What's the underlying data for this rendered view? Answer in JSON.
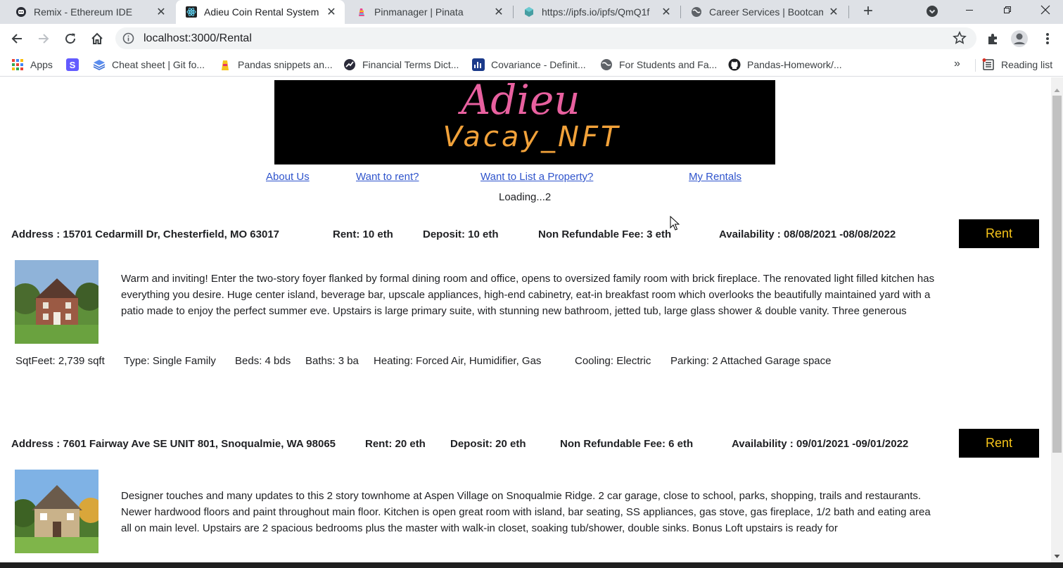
{
  "browser": {
    "tabs": [
      {
        "title": "Remix - Ethereum IDE",
        "icon": "remix-icon"
      },
      {
        "title": "Adieu Coin Rental System",
        "icon": "react-icon"
      },
      {
        "title": "Pinmanager | Pinata",
        "icon": "pinata-icon"
      },
      {
        "title": "https://ipfs.io/ipfs/QmQ1f",
        "icon": "ipfs-cube-icon"
      },
      {
        "title": "Career Services | Bootcamp",
        "icon": "globe-icon"
      }
    ],
    "active_tab_index": 1,
    "url": "localhost:3000/Rental",
    "bookmarks": [
      {
        "label": "Apps",
        "icon": "apps-grid-icon"
      },
      {
        "label": "",
        "icon": "s-bookmark-icon"
      },
      {
        "label": "Cheat sheet | Git fo...",
        "icon": "blue-stack-icon"
      },
      {
        "label": "Pandas snippets an...",
        "icon": "yellow-bookmark-icon"
      },
      {
        "label": "Financial Terms Dict...",
        "icon": "investopedia-icon"
      },
      {
        "label": "Covariance - Definit...",
        "icon": "chart-bookmark-icon"
      },
      {
        "label": "For Students and Fa...",
        "icon": "globe-icon"
      },
      {
        "label": "Pandas-Homework/...",
        "icon": "github-icon"
      }
    ],
    "reading_list": "Reading list"
  },
  "site": {
    "banner": {
      "line1": "Adieu",
      "line2": "Vacay_NFT"
    },
    "nav": [
      "About Us",
      "Want to rent?",
      "Want to List a Property?",
      "My Rentals"
    ],
    "loading_text": "Loading...2"
  },
  "listings": [
    {
      "address": "Address : 15701 Cedarmill Dr, Chesterfield, MO 63017",
      "rent": "Rent: 10 eth",
      "deposit": "Deposit: 10 eth",
      "fee": "Non Refundable Fee: 3 eth",
      "availability": "Availability : 08/08/2021 -08/08/2022",
      "button": "Rent",
      "description": "Warm and inviting! Enter the two-story foyer flanked by formal dining room and office, opens to oversized family room with brick fireplace. The renovated light filled kitchen has everything you desire. Huge center island, beverage bar, upscale appliances, high-end cabinetry, eat-in breakfast room which overlooks the beautifully maintained yard with a patio made to enjoy the perfect summer eve. Upstairs is large primary suite, with stunning new bathroom, jetted tub, large glass shower & double vanity. Three generous",
      "features": {
        "sqft": "SqtFeet: 2,739 sqft",
        "type": "Type: Single Family",
        "beds": "Beds: 4 bds",
        "baths": "Baths: 3 ba",
        "heating": "Heating: Forced Air, Humidifier, Gas",
        "cooling": "Cooling: Electric",
        "parking": "Parking: 2 Attached Garage space"
      }
    },
    {
      "address": "Address : 7601 Fairway Ave SE UNIT 801, Snoqualmie, WA 98065",
      "rent": "Rent: 20 eth",
      "deposit": "Deposit: 20 eth",
      "fee": "Non Refundable Fee: 6 eth",
      "availability": "Availability : 09/01/2021 -09/01/2022",
      "button": "Rent",
      "description": "Designer touches and many updates to this 2 story townhome at Aspen Village on Snoqualmie Ridge. 2 car garage, close to school, parks, shopping, trails and restaurants. Newer hardwood floors and paint throughout main floor. Kitchen is open great room with island, bar seating, SS appliances, gas stove, gas fireplace, 1/2 bath and eating area all on main level. Upstairs are 2 spacious bedrooms plus the master with walk-in closet, soaking tub/shower, double sinks. Bonus Loft upstairs is ready for"
    }
  ],
  "colors": {
    "rent_button_bg": "#000000",
    "rent_button_text": "#f7c51a",
    "link": "#2f54cc",
    "banner_pink": "#e8609f",
    "banner_orange": "#f2a23a"
  }
}
